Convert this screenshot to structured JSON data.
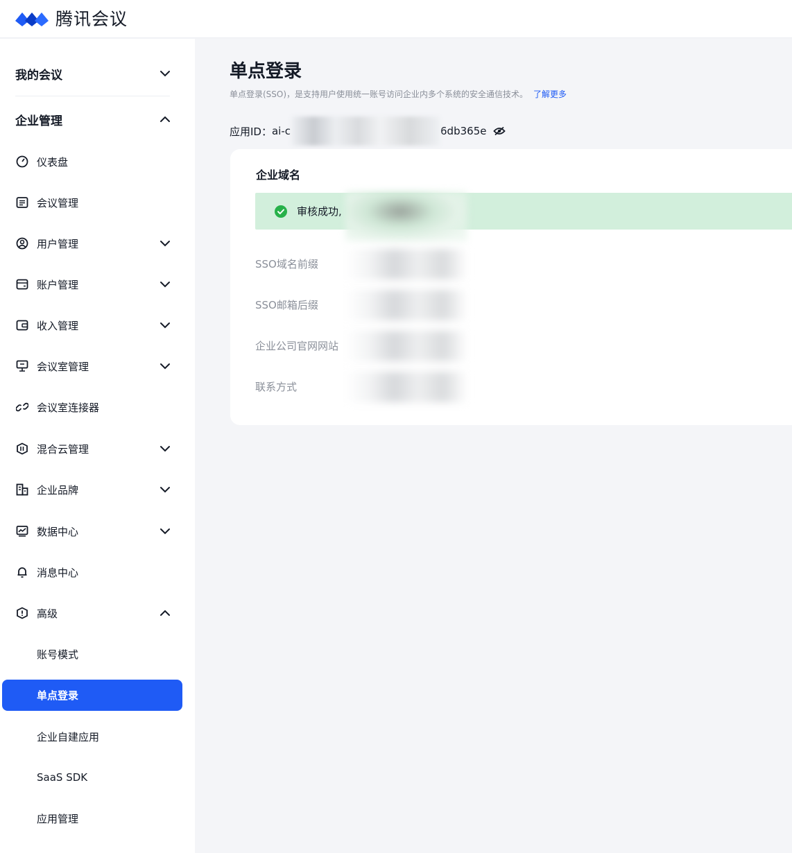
{
  "brand": {
    "name": "腾讯会议",
    "colors": {
      "blue": "#1f5bf5",
      "dark_blue": "#0a3cc7"
    }
  },
  "sidebar": {
    "my_meetings": "我的会议",
    "enterprise_mgmt": "企业管理",
    "items": [
      {
        "label": "仪表盘",
        "icon": "dashboard-icon",
        "has_chevron": false
      },
      {
        "label": "会议管理",
        "icon": "meeting-list-icon",
        "has_chevron": false
      },
      {
        "label": "用户管理",
        "icon": "user-icon",
        "has_chevron": true
      },
      {
        "label": "账户管理",
        "icon": "wallet-icon",
        "has_chevron": true
      },
      {
        "label": "收入管理",
        "icon": "income-icon",
        "has_chevron": true
      },
      {
        "label": "会议室管理",
        "icon": "meeting-room-icon",
        "has_chevron": true
      },
      {
        "label": "会议室连接器",
        "icon": "link-icon",
        "has_chevron": false
      },
      {
        "label": "混合云管理",
        "icon": "hybrid-cloud-icon",
        "has_chevron": true
      },
      {
        "label": "企业品牌",
        "icon": "building-icon",
        "has_chevron": true
      },
      {
        "label": "数据中心",
        "icon": "chart-icon",
        "has_chevron": true
      },
      {
        "label": "消息中心",
        "icon": "bell-icon",
        "has_chevron": false
      },
      {
        "label": "高级",
        "icon": "advanced-shield-icon",
        "has_chevron": true,
        "expanded": true
      }
    ],
    "advanced_sub": [
      "账号模式",
      "单点登录",
      "企业自建应用",
      "SaaS SDK",
      "应用管理"
    ],
    "active_sub": "单点登录"
  },
  "main": {
    "title": "单点登录",
    "description": "单点登录(SSO)，是支持用户使用统一账号访问企业内多个系统的安全通信技术。",
    "learn_more": "了解更多",
    "app_id_label": "应用ID：",
    "app_id_prefix": "ai-c",
    "app_id_suffix": "6db365e",
    "card": {
      "title": "企业域名",
      "success_text": "审核成功,",
      "fields": [
        "SSO域名前缀",
        "SSO邮箱后缀",
        "企业公司官网网站",
        "联系方式"
      ]
    }
  }
}
